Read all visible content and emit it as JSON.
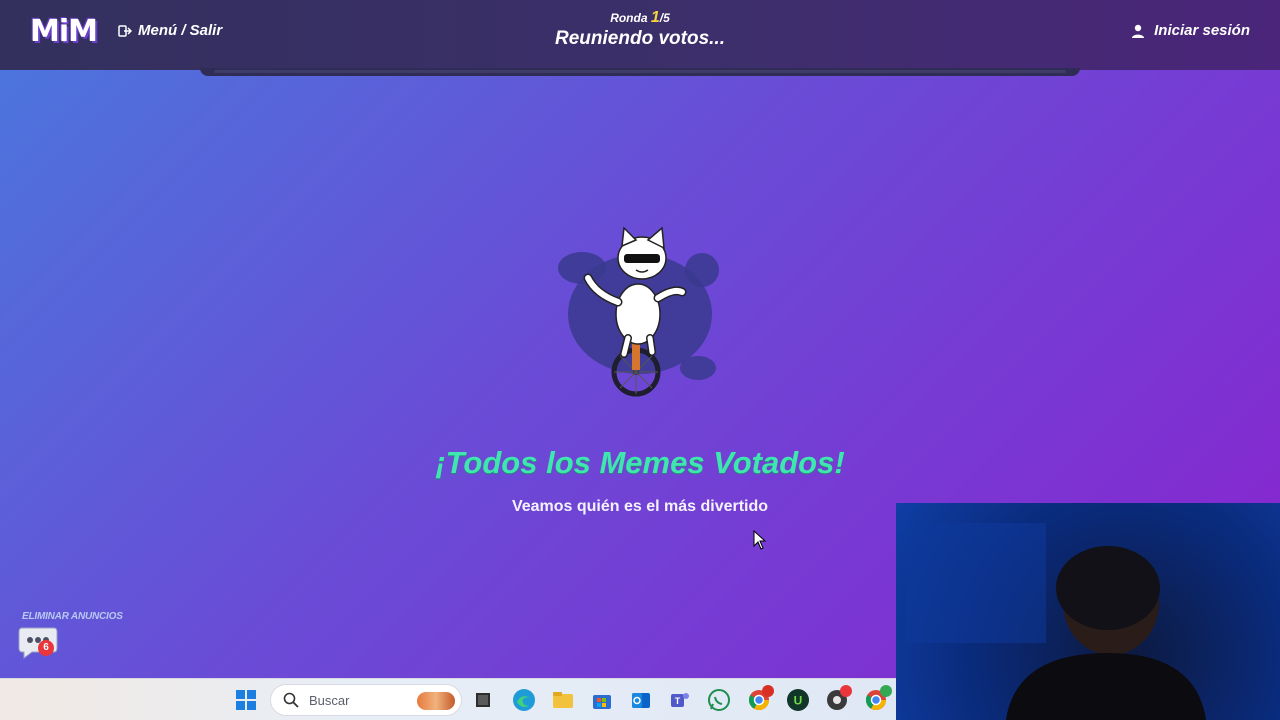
{
  "app": {
    "logo_text": "MiM",
    "menu_exit_label": "Menú / Salir",
    "round_label": "Ronda",
    "round_current": "1",
    "round_total": "/5",
    "round_status": "Reuniendo votos...",
    "login_label": "Iniciar sesión"
  },
  "main": {
    "headline": "¡Todos los Memes Votados!",
    "subline": "Veamos quién es el más divertido"
  },
  "ads": {
    "remove_label": "ELIMINAR ANUNCIOS",
    "badge_count": "6"
  },
  "taskbar": {
    "search_placeholder": "Buscar",
    "icons": [
      "start-icon",
      "search-icon",
      "task-view-icon",
      "edge-icon",
      "file-explorer-icon",
      "store-icon",
      "outlook-icon",
      "teams-icon",
      "whatsapp-icon",
      "chrome-icon",
      "upwork-icon",
      "media-icon",
      "chrome-profile-icon"
    ]
  },
  "colors": {
    "headline": "#3fe6b0",
    "round_current": "#f7d43b",
    "topbar": "#33305d",
    "gradient_start": "#4a78dd",
    "gradient_end": "#8a22cf",
    "badge_red": "#e8363b"
  }
}
